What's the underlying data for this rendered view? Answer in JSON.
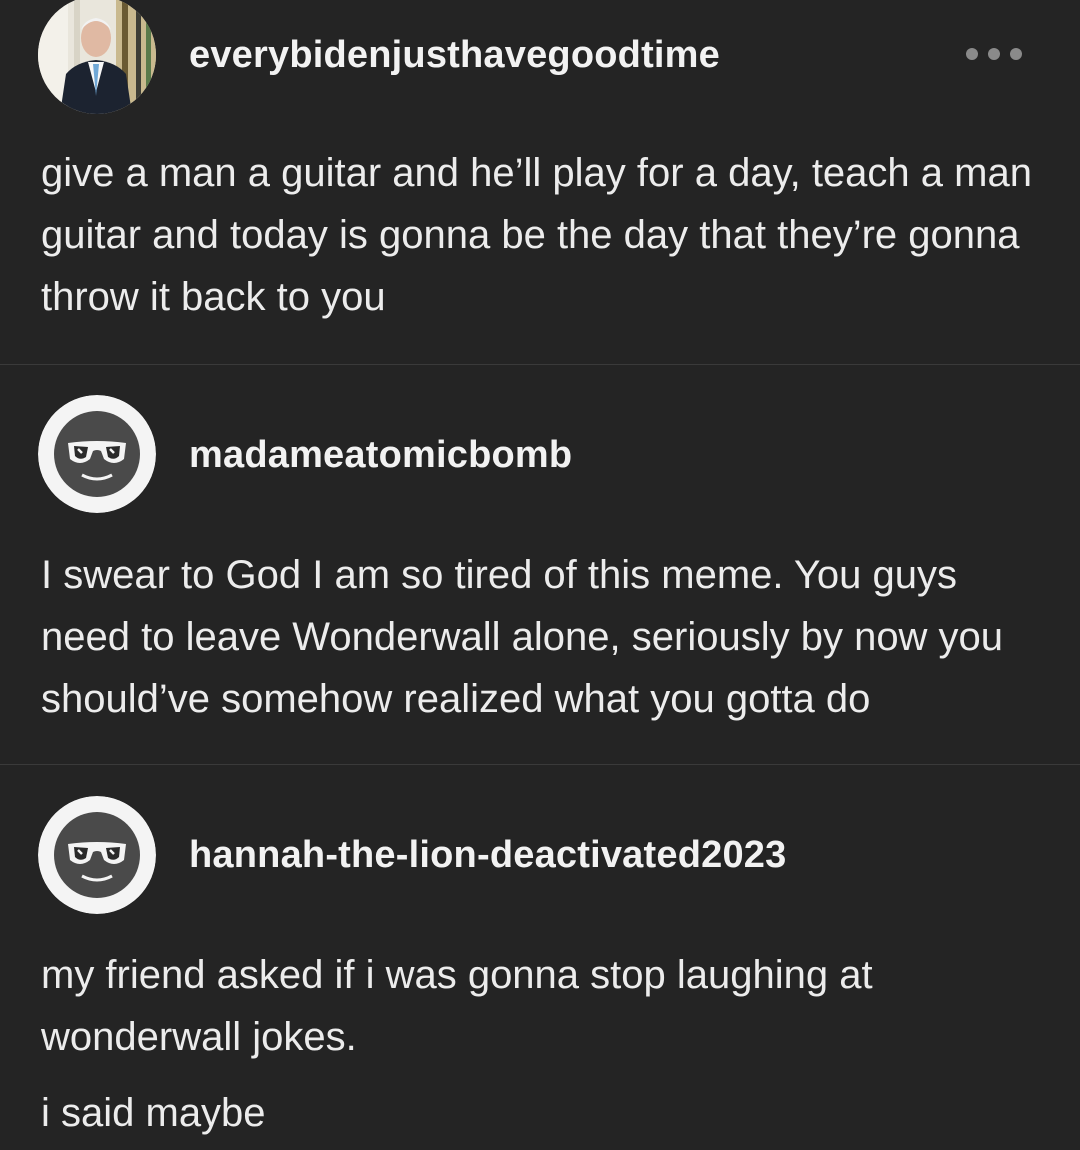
{
  "posts": [
    {
      "username": "everybidenjusthavegoodtime",
      "avatar": "photo-avatar",
      "text": [
        "give a man a guitar and he’ll play for a day, teach a man guitar and today is gonna be the day that they’re gonna throw it back to you"
      ]
    },
    {
      "username": "madameatomicbomb",
      "avatar": "sunglasses-face-avatar",
      "text": [
        "I swear to God I am so tired of this meme. You guys need to leave Wonderwall alone, seriously by now you should’ve somehow realized what you gotta do"
      ]
    },
    {
      "username": "hannah-the-lion-deactivated2023",
      "avatar": "sunglasses-face-avatar",
      "text": [
        "my friend asked if i was gonna stop laughing at wonderwall jokes.",
        "i said maybe"
      ]
    }
  ],
  "icons": {
    "more": "more-options-icon"
  },
  "colors": {
    "background": "#242424",
    "text": "#ececec",
    "divider": "#3a3a3a",
    "more_dots": "#8a8a8a"
  }
}
